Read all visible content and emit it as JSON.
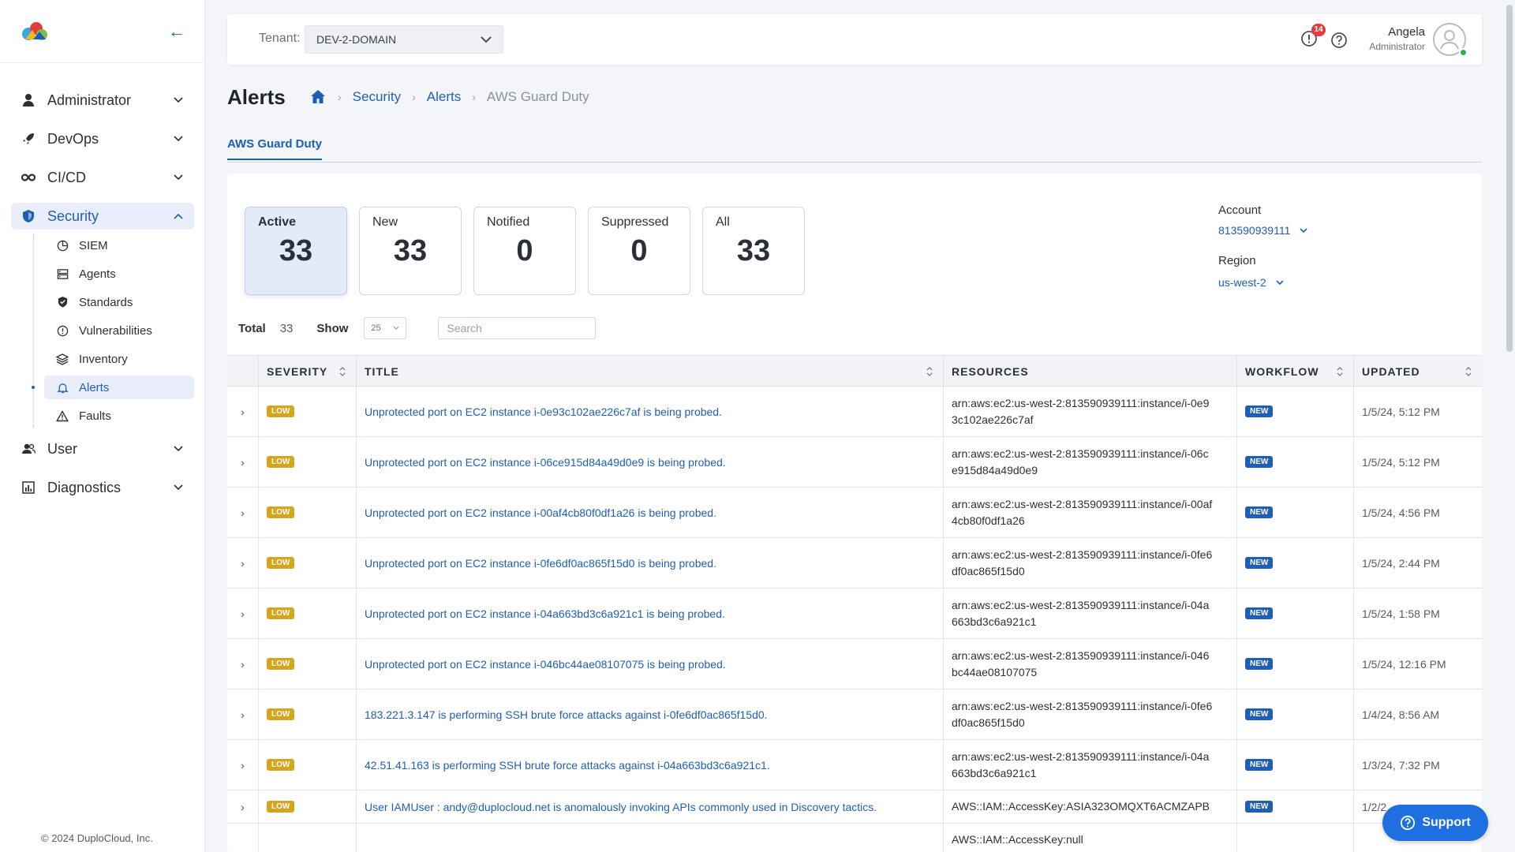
{
  "sidebar": {
    "collapse_icon": "arrow-left-icon",
    "items": [
      {
        "label": "Administrator",
        "icon": "user-icon"
      },
      {
        "label": "DevOps",
        "icon": "rocket-icon"
      },
      {
        "label": "CI/CD",
        "icon": "infinity-icon"
      },
      {
        "label": "Security",
        "icon": "shield-icon"
      },
      {
        "label": "User",
        "icon": "users-icon"
      },
      {
        "label": "Diagnostics",
        "icon": "chart-icon"
      }
    ],
    "security_sub": [
      {
        "label": "SIEM",
        "icon": "pie-icon"
      },
      {
        "label": "Agents",
        "icon": "server-icon"
      },
      {
        "label": "Standards",
        "icon": "shield-check-icon"
      },
      {
        "label": "Vulnerabilities",
        "icon": "alert-circle-icon"
      },
      {
        "label": "Inventory",
        "icon": "layers-icon"
      },
      {
        "label": "Alerts",
        "icon": "bell-icon"
      },
      {
        "label": "Faults",
        "icon": "warning-icon"
      }
    ],
    "copyright": "© 2024  DuploCloud, Inc."
  },
  "header": {
    "tenant_label": "Tenant:",
    "tenant_value": "DEV-2-DOMAIN",
    "notification_count": "14",
    "user_name": "Angela",
    "user_role": "Administrator"
  },
  "page": {
    "title": "Alerts",
    "breadcrumbs": [
      "Security",
      "Alerts"
    ],
    "breadcrumb_current": "AWS Guard Duty",
    "tab": "AWS Guard Duty"
  },
  "stats": [
    {
      "label": "Active",
      "value": "33"
    },
    {
      "label": "New",
      "value": "33"
    },
    {
      "label": "Notified",
      "value": "0"
    },
    {
      "label": "Suppressed",
      "value": "0"
    },
    {
      "label": "All",
      "value": "33"
    }
  ],
  "filters": {
    "account_label": "Account",
    "account_value": "813590939111",
    "region_label": "Region",
    "region_value": "us-west-2"
  },
  "controls": {
    "total_label": "Total",
    "total_value": "33",
    "show_label": "Show",
    "page_size": "25",
    "search_placeholder": "Search"
  },
  "table": {
    "headers": [
      "SEVERITY",
      "TITLE",
      "RESOURCES",
      "WORKFLOW",
      "UPDATED"
    ],
    "rows": [
      {
        "severity": "LOW",
        "title": "Unprotected port on EC2 instance i-0e93c102ae226c7af is being probed.",
        "resource": "arn:aws:ec2:us-west-2:813590939111:instance/i-0e93c102ae226c7af",
        "workflow": "NEW",
        "updated": "1/5/24, 5:12 PM"
      },
      {
        "severity": "LOW",
        "title": "Unprotected port on EC2 instance i-06ce915d84a49d0e9 is being probed.",
        "resource": "arn:aws:ec2:us-west-2:813590939111:instance/i-06ce915d84a49d0e9",
        "workflow": "NEW",
        "updated": "1/5/24, 5:12 PM"
      },
      {
        "severity": "LOW",
        "title": "Unprotected port on EC2 instance i-00af4cb80f0df1a26 is being probed.",
        "resource": "arn:aws:ec2:us-west-2:813590939111:instance/i-00af4cb80f0df1a26",
        "workflow": "NEW",
        "updated": "1/5/24, 4:56 PM"
      },
      {
        "severity": "LOW",
        "title": "Unprotected port on EC2 instance i-0fe6df0ac865f15d0 is being probed.",
        "resource": "arn:aws:ec2:us-west-2:813590939111:instance/i-0fe6df0ac865f15d0",
        "workflow": "NEW",
        "updated": "1/5/24, 2:44 PM"
      },
      {
        "severity": "LOW",
        "title": "Unprotected port on EC2 instance i-04a663bd3c6a921c1 is being probed.",
        "resource": "arn:aws:ec2:us-west-2:813590939111:instance/i-04a663bd3c6a921c1",
        "workflow": "NEW",
        "updated": "1/5/24, 1:58 PM"
      },
      {
        "severity": "LOW",
        "title": "Unprotected port on EC2 instance i-046bc44ae08107075 is being probed.",
        "resource": "arn:aws:ec2:us-west-2:813590939111:instance/i-046bc44ae08107075",
        "workflow": "NEW",
        "updated": "1/5/24, 12:16 PM"
      },
      {
        "severity": "LOW",
        "title": "183.221.3.147 is performing SSH brute force attacks against i-0fe6df0ac865f15d0.",
        "resource": "arn:aws:ec2:us-west-2:813590939111:instance/i-0fe6df0ac865f15d0",
        "workflow": "NEW",
        "updated": "1/4/24, 8:56 AM"
      },
      {
        "severity": "LOW",
        "title": "42.51.41.163 is performing SSH brute force attacks against i-04a663bd3c6a921c1.",
        "resource": "arn:aws:ec2:us-west-2:813590939111:instance/i-04a663bd3c6a921c1",
        "workflow": "NEW",
        "updated": "1/3/24, 7:32 PM"
      },
      {
        "severity": "LOW",
        "title": "User IAMUser : andy@duplocloud.net is anomalously invoking APIs commonly used in Discovery tactics.",
        "resource": "AWS::IAM::AccessKey:ASIA323OMQXT6ACMZAPB",
        "workflow": "NEW",
        "updated": "1/2/2"
      },
      {
        "severity": "",
        "title": "",
        "resource": "AWS::IAM::AccessKey:null",
        "workflow": "",
        "updated": ""
      }
    ]
  },
  "support": {
    "label": "Support"
  }
}
